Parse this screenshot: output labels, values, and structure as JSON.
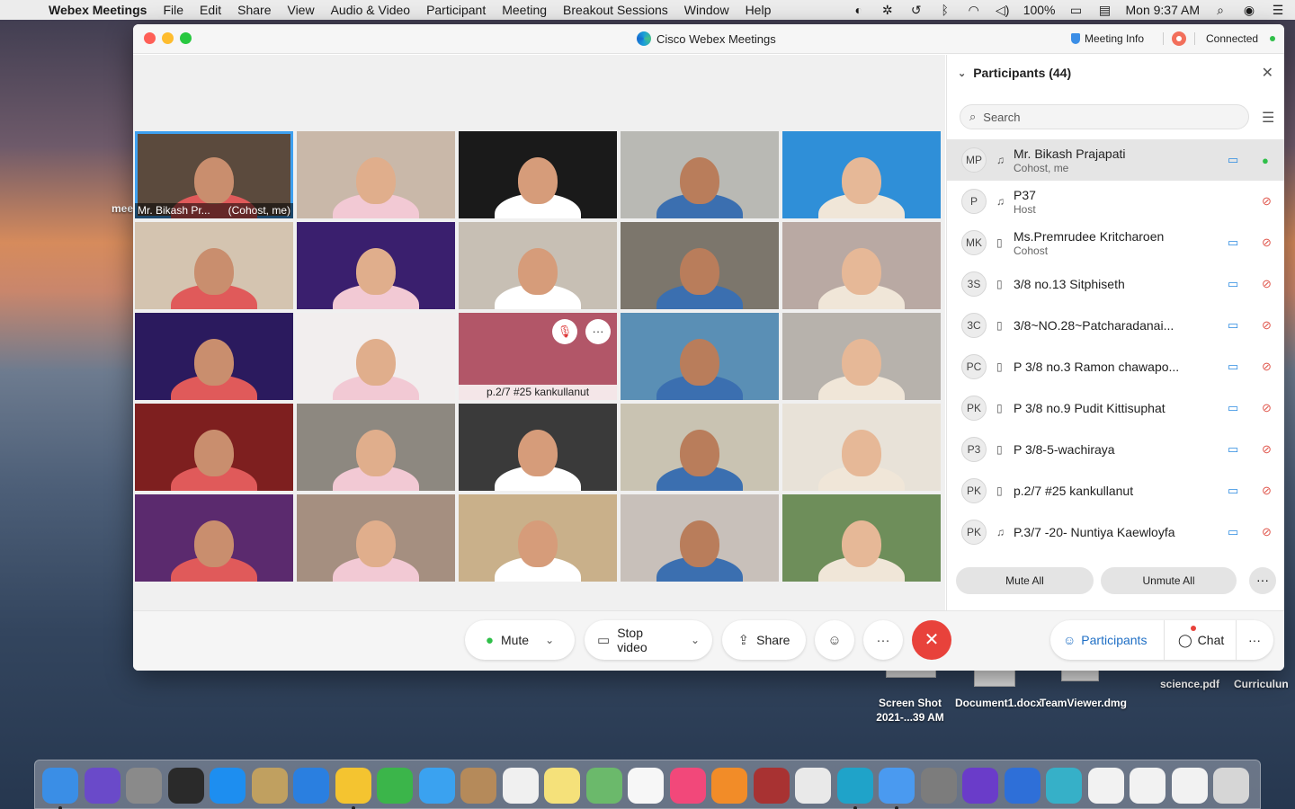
{
  "menubar": {
    "app_name": "Webex Meetings",
    "items": [
      "File",
      "Edit",
      "Share",
      "View",
      "Audio & Video",
      "Participant",
      "Meeting",
      "Breakout Sessions",
      "Window",
      "Help"
    ],
    "battery": "100%",
    "clock": "Mon 9:37 AM"
  },
  "desktop": {
    "files": [
      {
        "label": "Screen Shot 2021-...39 AM"
      },
      {
        "label": "Document1.docx"
      },
      {
        "label": "TeamViewer.dmg"
      },
      {
        "label": "science.pdf"
      },
      {
        "label": "Curriculun"
      }
    ],
    "edge_text": "mee"
  },
  "window": {
    "title": "Cisco Webex Meetings",
    "meeting_info": "Meeting Info",
    "connection": "Connected"
  },
  "video": {
    "self_name": "Mr. Bikash Pr...",
    "self_tag": "(Cohost, me)",
    "hover_tile_name": "p.2/7 #25 kankullanut",
    "tile_colors": [
      "#5b4a3d",
      "#c9b8a9",
      "#1a1a1a",
      "#b9b9b4",
      "#2f8fd8",
      "#d4c4b0",
      "#3a1f6e",
      "#c7bfb4",
      "#7c766c",
      "#b9a9a3",
      "#2b1a5e",
      "#f2eeee",
      "#b25668",
      "#5a8fb5",
      "#b7b2ac",
      "#7e1f1f",
      "#8d8880",
      "#3a3a3a",
      "#c9c3b2",
      "#e8e2d8",
      "#5b2a6e",
      "#a58f80",
      "#c9b08a",
      "#c8c0ba",
      "#6e8e5a"
    ]
  },
  "controls": {
    "mute": "Mute",
    "stop_video": "Stop video",
    "share": "Share",
    "participants": "Participants",
    "chat": "Chat"
  },
  "panel": {
    "title": "Participants (44)",
    "search_placeholder": "Search",
    "mute_all": "Mute All",
    "unmute_all": "Unmute All",
    "participants": [
      {
        "initials": "MP",
        "name": "Mr. Bikash Prajapati",
        "role": "Cohost, me",
        "device": "headset",
        "mic": "on",
        "selected": true
      },
      {
        "initials": "P",
        "name": "P37",
        "role": "Host",
        "device": "headset",
        "mic": "muted",
        "selected": false,
        "no_cam": true
      },
      {
        "initials": "MK",
        "name": "Ms.Premrudee Kritcharoen",
        "role": "Cohost",
        "device": "phone",
        "mic": "muted",
        "selected": false
      },
      {
        "initials": "3S",
        "name": "3/8 no.13 Sitphiseth",
        "role": "",
        "device": "phone",
        "mic": "muted",
        "selected": false
      },
      {
        "initials": "3C",
        "name": "3/8~NO.28~Patcharadanai...",
        "role": "",
        "device": "phone",
        "mic": "muted",
        "selected": false
      },
      {
        "initials": "PC",
        "name": "P 3/8 no.3 Ramon chawapo...",
        "role": "",
        "device": "phone",
        "mic": "muted",
        "selected": false
      },
      {
        "initials": "PK",
        "name": "P 3/8 no.9 Pudit Kittisuphat",
        "role": "",
        "device": "phone",
        "mic": "muted",
        "selected": false
      },
      {
        "initials": "P3",
        "name": "P 3/8-5-wachiraya",
        "role": "",
        "device": "phone",
        "mic": "muted",
        "selected": false
      },
      {
        "initials": "PK",
        "name": "p.2/7 #25 kankullanut",
        "role": "",
        "device": "phone",
        "mic": "muted",
        "selected": false
      },
      {
        "initials": "PK",
        "name": "P.3/7 -20- Nuntiya Kaewloyfa",
        "role": "",
        "device": "headset",
        "mic": "muted",
        "selected": false
      }
    ]
  }
}
